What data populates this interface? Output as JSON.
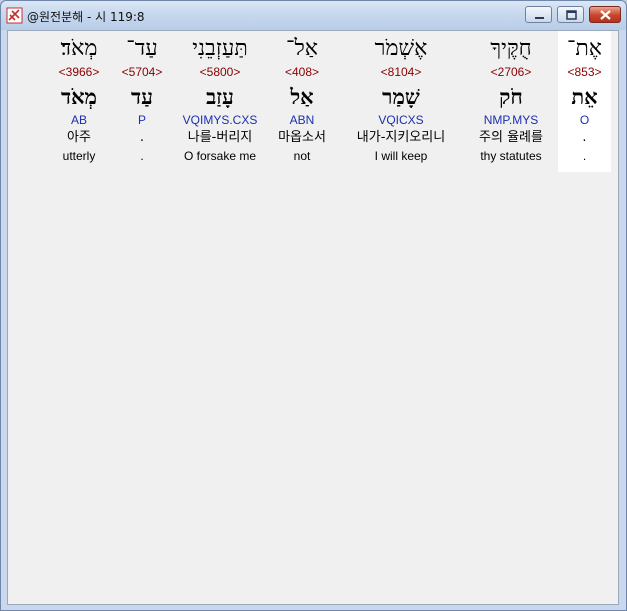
{
  "window": {
    "title": "@원전분해 - 시 119:8"
  },
  "words": [
    {
      "hebrew": "מְאֹד׃",
      "strong": "<3966>",
      "lemma": "מְאֹד",
      "morph": "AB",
      "korean": "아주",
      "english": "utterly"
    },
    {
      "hebrew": "עַד־",
      "strong": "<5704>",
      "lemma": "עַד",
      "morph": "P",
      "korean": ".",
      "english": "."
    },
    {
      "hebrew": "תַּעַזְבֵנִי",
      "strong": "<5800>",
      "lemma": "עָזַב",
      "morph": "VQIMYS.CXS",
      "korean": "나를-버리지",
      "english": "O forsake me"
    },
    {
      "hebrew": "אַל־",
      "strong": "<408>",
      "lemma": "אַל",
      "morph": "ABN",
      "korean": "마옵소서",
      "english": "not"
    },
    {
      "hebrew": "אֶשְׁמֹר",
      "strong": "<8104>",
      "lemma": "שָׁמַר",
      "morph": "VQICXS",
      "korean": "내가-지키오리니",
      "english": "I will keep"
    },
    {
      "hebrew": "חֻקֶּיךָ",
      "strong": "<2706>",
      "lemma": "חֹק",
      "morph": "NMP.MYS",
      "korean": "주의 율례를",
      "english": "thy statutes"
    },
    {
      "hebrew": "אֶת־",
      "strong": "<853>",
      "lemma": "אֵת",
      "morph": "O",
      "korean": ".",
      "english": "."
    }
  ]
}
